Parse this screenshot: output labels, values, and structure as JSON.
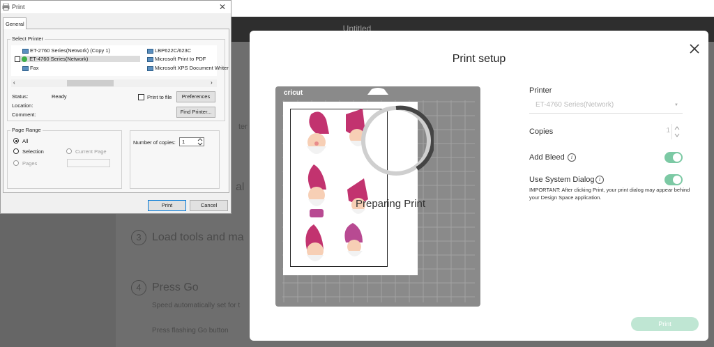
{
  "app": {
    "title": "Untitled",
    "bg_text_1": "ter of",
    "bg_text_2": "al",
    "step3": {
      "number": "3",
      "label": "Load tools and ma"
    },
    "step4": {
      "number": "4",
      "label": "Press Go",
      "sub": "Speed automatically set for t",
      "sub2": "Press flashing Go button"
    }
  },
  "print_setup": {
    "title": "Print setup",
    "mat_brand": "cricut",
    "status_text": "Preparing Print",
    "printer_label": "Printer",
    "printer_value": "ET-4760 Series(Network)",
    "copies_label": "Copies",
    "copies_value": "1",
    "add_bleed_label": "Add Bleed",
    "add_bleed_on": true,
    "use_system_dialog_label": "Use System Dialog",
    "use_system_dialog_on": true,
    "important_text": "IMPORTANT: After clicking Print, your print dialog may appear behind your Design Space application.",
    "print_button": "Print",
    "colors": {
      "toggle": "#7cc9a4",
      "print_button": "#bfe6d3",
      "mat": "#8a8a8a"
    }
  },
  "win_dialog": {
    "title": "Print",
    "tab": "General",
    "select_printer_legend": "Select Printer",
    "printers": [
      {
        "name": "ET-2760 Series(Network) (Copy 1)",
        "selected": false,
        "default": false
      },
      {
        "name": "LBP622C/623C",
        "selected": false,
        "default": false
      },
      {
        "name": "ET-4760 Series(Network)",
        "selected": true,
        "default": true
      },
      {
        "name": "Microsoft Print to PDF",
        "selected": false,
        "default": false
      },
      {
        "name": "Fax",
        "selected": false,
        "default": false
      },
      {
        "name": "Microsoft XPS Document Writer",
        "selected": false,
        "default": false
      }
    ],
    "status_label": "Status:",
    "status_value": "Ready",
    "location_label": "Location:",
    "comment_label": "Comment:",
    "print_to_file_label": "Print to file",
    "preferences_button": "Preferences",
    "find_printer_button": "Find Printer...",
    "page_range_legend": "Page Range",
    "range_all": "All",
    "range_selection": "Selection",
    "range_current_page": "Current Page",
    "range_pages": "Pages",
    "copies_label": "Number of copies:",
    "copies_value": "1",
    "print_button": "Print",
    "cancel_button": "Cancel"
  }
}
